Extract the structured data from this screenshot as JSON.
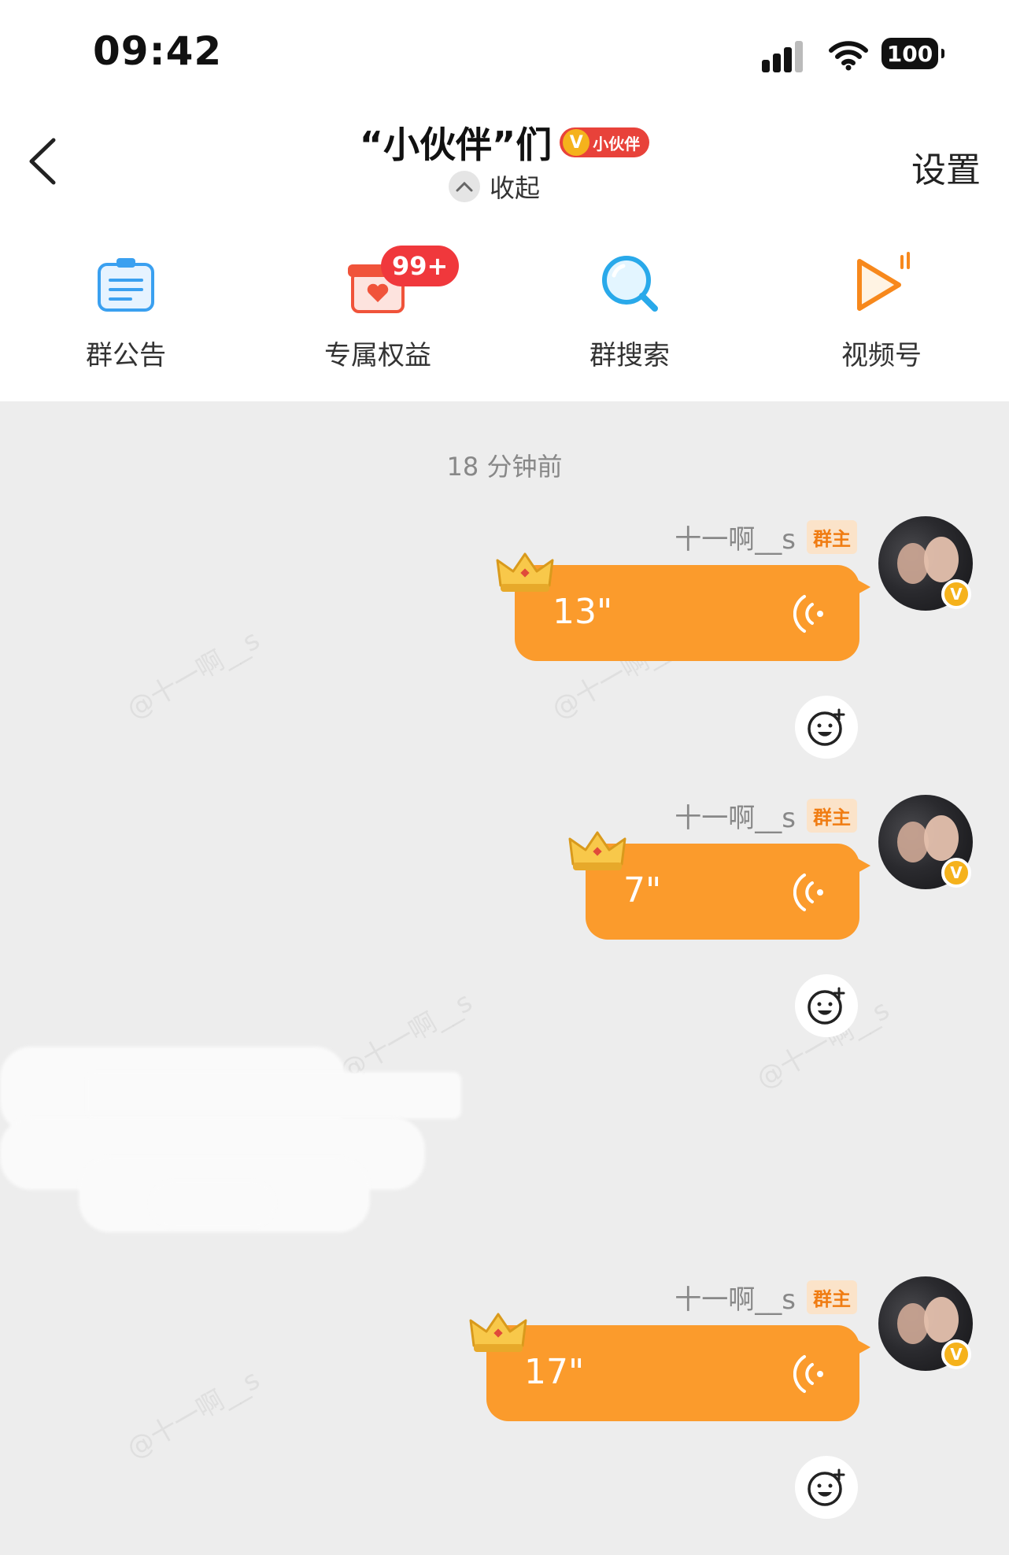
{
  "status_bar": {
    "time": "09:42",
    "battery": "100"
  },
  "header": {
    "title": "“小伙伴”们",
    "badge_v": "V",
    "badge_text": "小伙伴",
    "collapse_label": "收起",
    "settings_label": "设置"
  },
  "features": [
    {
      "label": "群公告",
      "icon": "announcement-icon"
    },
    {
      "label": "专属权益",
      "icon": "gift-box-icon",
      "badge": "99+"
    },
    {
      "label": "群搜索",
      "icon": "search-icon"
    },
    {
      "label": "视频号",
      "icon": "video-channel-icon"
    }
  ],
  "chat": {
    "time_separator": "18 分钟前",
    "watermark": "@十一啊__s",
    "messages": [
      {
        "sender": "十一啊__s",
        "role": "群主",
        "duration": "13\"",
        "avatar_badge": "V"
      },
      {
        "sender": "十一啊__s",
        "role": "群主",
        "duration": "7\"",
        "avatar_badge": "V"
      },
      {
        "sender": "十一啊__s",
        "role": "群主",
        "duration": "17\"",
        "avatar_badge": "V"
      }
    ]
  },
  "colors": {
    "bubble": "#fb9b2c",
    "role_tag_bg": "#fbe3c9",
    "role_tag_text": "#f07c12",
    "badge_red": "#f0383c"
  }
}
